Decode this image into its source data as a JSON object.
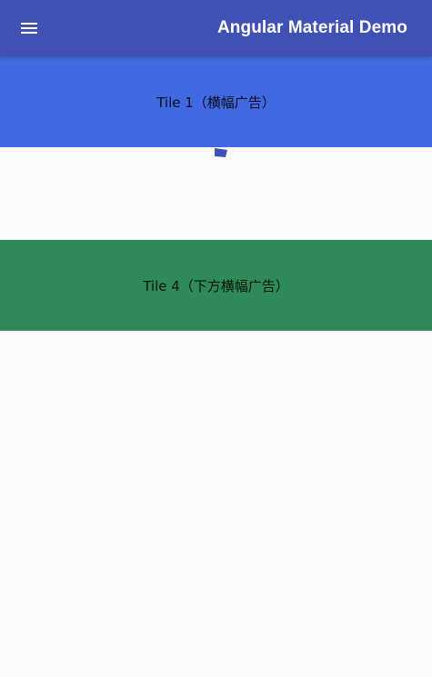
{
  "colors": {
    "toolbar_bg": "#3f51b5",
    "tile1_bg": "#4169e1",
    "tile4_bg": "#2e8b57",
    "page_bg": "#fafafa",
    "marker": "#3f51b5"
  },
  "toolbar": {
    "menu_icon": "hamburger-menu",
    "title": "Angular Material Demo"
  },
  "tiles": [
    {
      "label": "Tile 1（横幅广告）"
    },
    {
      "label": "Tile 4（下方横幅广告）"
    }
  ]
}
